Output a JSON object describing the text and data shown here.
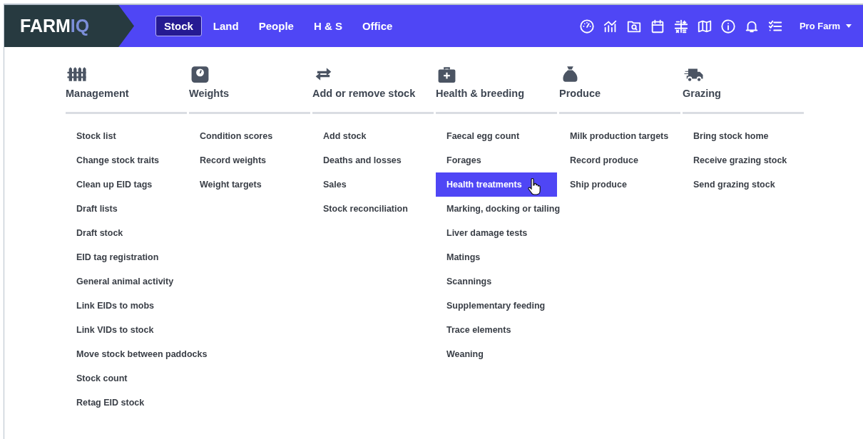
{
  "brand": {
    "name": "FARM",
    "accent": "IQ"
  },
  "nav": [
    {
      "label": "Stock",
      "selected": true
    },
    {
      "label": "Land",
      "selected": false
    },
    {
      "label": "People",
      "selected": false
    },
    {
      "label": "H & S",
      "selected": false
    },
    {
      "label": "Office",
      "selected": false
    }
  ],
  "toolbar": [
    {
      "kind": "gauge"
    },
    {
      "kind": "chart"
    },
    {
      "kind": "folder"
    },
    {
      "kind": "calendar"
    },
    {
      "kind": "calc"
    },
    {
      "kind": "map"
    },
    {
      "kind": "info"
    },
    {
      "kind": "bell"
    },
    {
      "kind": "list"
    }
  ],
  "account": {
    "label": "Pro Farm"
  },
  "columns": [
    {
      "kind": "fence",
      "title": "Management",
      "items": [
        {
          "label": "Stock list",
          "selected": false
        },
        {
          "label": "Change stock traits",
          "selected": false
        },
        {
          "label": "Clean up EID tags",
          "selected": false
        },
        {
          "label": "Draft lists",
          "selected": false
        },
        {
          "label": "Draft stock",
          "selected": false
        },
        {
          "label": "EID tag registration",
          "selected": false
        },
        {
          "label": "General animal activity",
          "selected": false
        },
        {
          "label": "Link EIDs to mobs",
          "selected": false
        },
        {
          "label": "Link VIDs to stock",
          "selected": false
        },
        {
          "label": "Move stock between paddocks",
          "selected": false
        },
        {
          "label": "Stock count",
          "selected": false
        },
        {
          "label": "Retag EID stock",
          "selected": false
        }
      ]
    },
    {
      "kind": "scale",
      "title": "Weights",
      "items": [
        {
          "label": "Condition scores",
          "selected": false
        },
        {
          "label": "Record weights",
          "selected": false
        },
        {
          "label": "Weight targets",
          "selected": false
        }
      ]
    },
    {
      "kind": "swap",
      "title": "Add or remove stock",
      "items": [
        {
          "label": "Add stock",
          "selected": false
        },
        {
          "label": "Deaths and losses",
          "selected": false
        },
        {
          "label": "Sales",
          "selected": false
        },
        {
          "label": "Stock reconciliation",
          "selected": false
        }
      ]
    },
    {
      "kind": "medkit",
      "title": "Health & breeding",
      "items": [
        {
          "label": "Faecal egg count",
          "selected": false
        },
        {
          "label": "Forages",
          "selected": false
        },
        {
          "label": "Health treatments",
          "selected": true
        },
        {
          "label": "Marking, docking or tailing",
          "selected": false
        },
        {
          "label": "Liver damage tests",
          "selected": false
        },
        {
          "label": "Matings",
          "selected": false
        },
        {
          "label": "Scannings",
          "selected": false
        },
        {
          "label": "Supplementary feeding",
          "selected": false
        },
        {
          "label": "Trace elements",
          "selected": false
        },
        {
          "label": "Weaning",
          "selected": false
        }
      ]
    },
    {
      "kind": "sack",
      "title": "Produce",
      "items": [
        {
          "label": "Milk production targets",
          "selected": false
        },
        {
          "label": "Record produce",
          "selected": false
        },
        {
          "label": "Ship produce",
          "selected": false
        }
      ]
    },
    {
      "kind": "truck",
      "title": "Grazing",
      "items": [
        {
          "label": "Bring stock home",
          "selected": false
        },
        {
          "label": "Receive grazing stock",
          "selected": false
        },
        {
          "label": "Send grazing stock",
          "selected": false
        }
      ]
    }
  ]
}
